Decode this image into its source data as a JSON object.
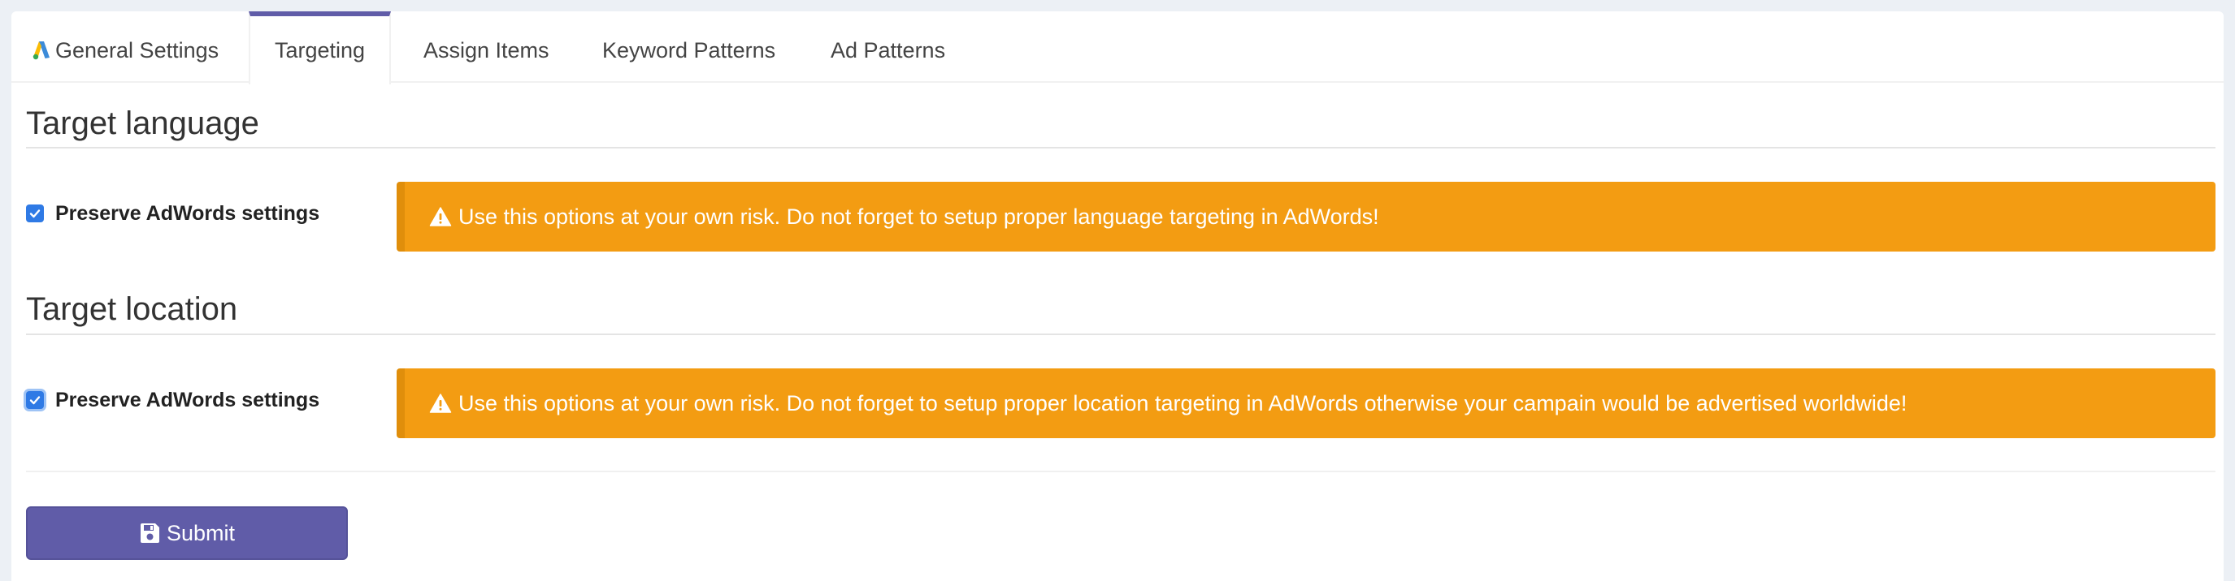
{
  "tabs": {
    "general": "General Settings",
    "targeting": "Targeting",
    "assign": "Assign Items",
    "keyword": "Keyword Patterns",
    "ad": "Ad Patterns",
    "active": "targeting",
    "general_icon": "adwords-logo-icon"
  },
  "language": {
    "title": "Target language",
    "checkbox_label": "Preserve AdWords settings",
    "checked": true,
    "warning": "Use this options at your own risk. Do not forget to setup proper language targeting in AdWords!"
  },
  "location": {
    "title": "Target location",
    "checkbox_label": "Preserve AdWords settings",
    "checked": true,
    "warning": "Use this options at your own risk. Do not forget to setup proper location targeting in AdWords otherwise your campain would be advertised worldwide!"
  },
  "form": {
    "submit_label": "Submit",
    "submit_icon": "save-icon"
  },
  "colors": {
    "accent": "#605ca8",
    "warning": "#f39c12",
    "checkbox": "#2f7ae5",
    "background": "#ecf0f5"
  }
}
